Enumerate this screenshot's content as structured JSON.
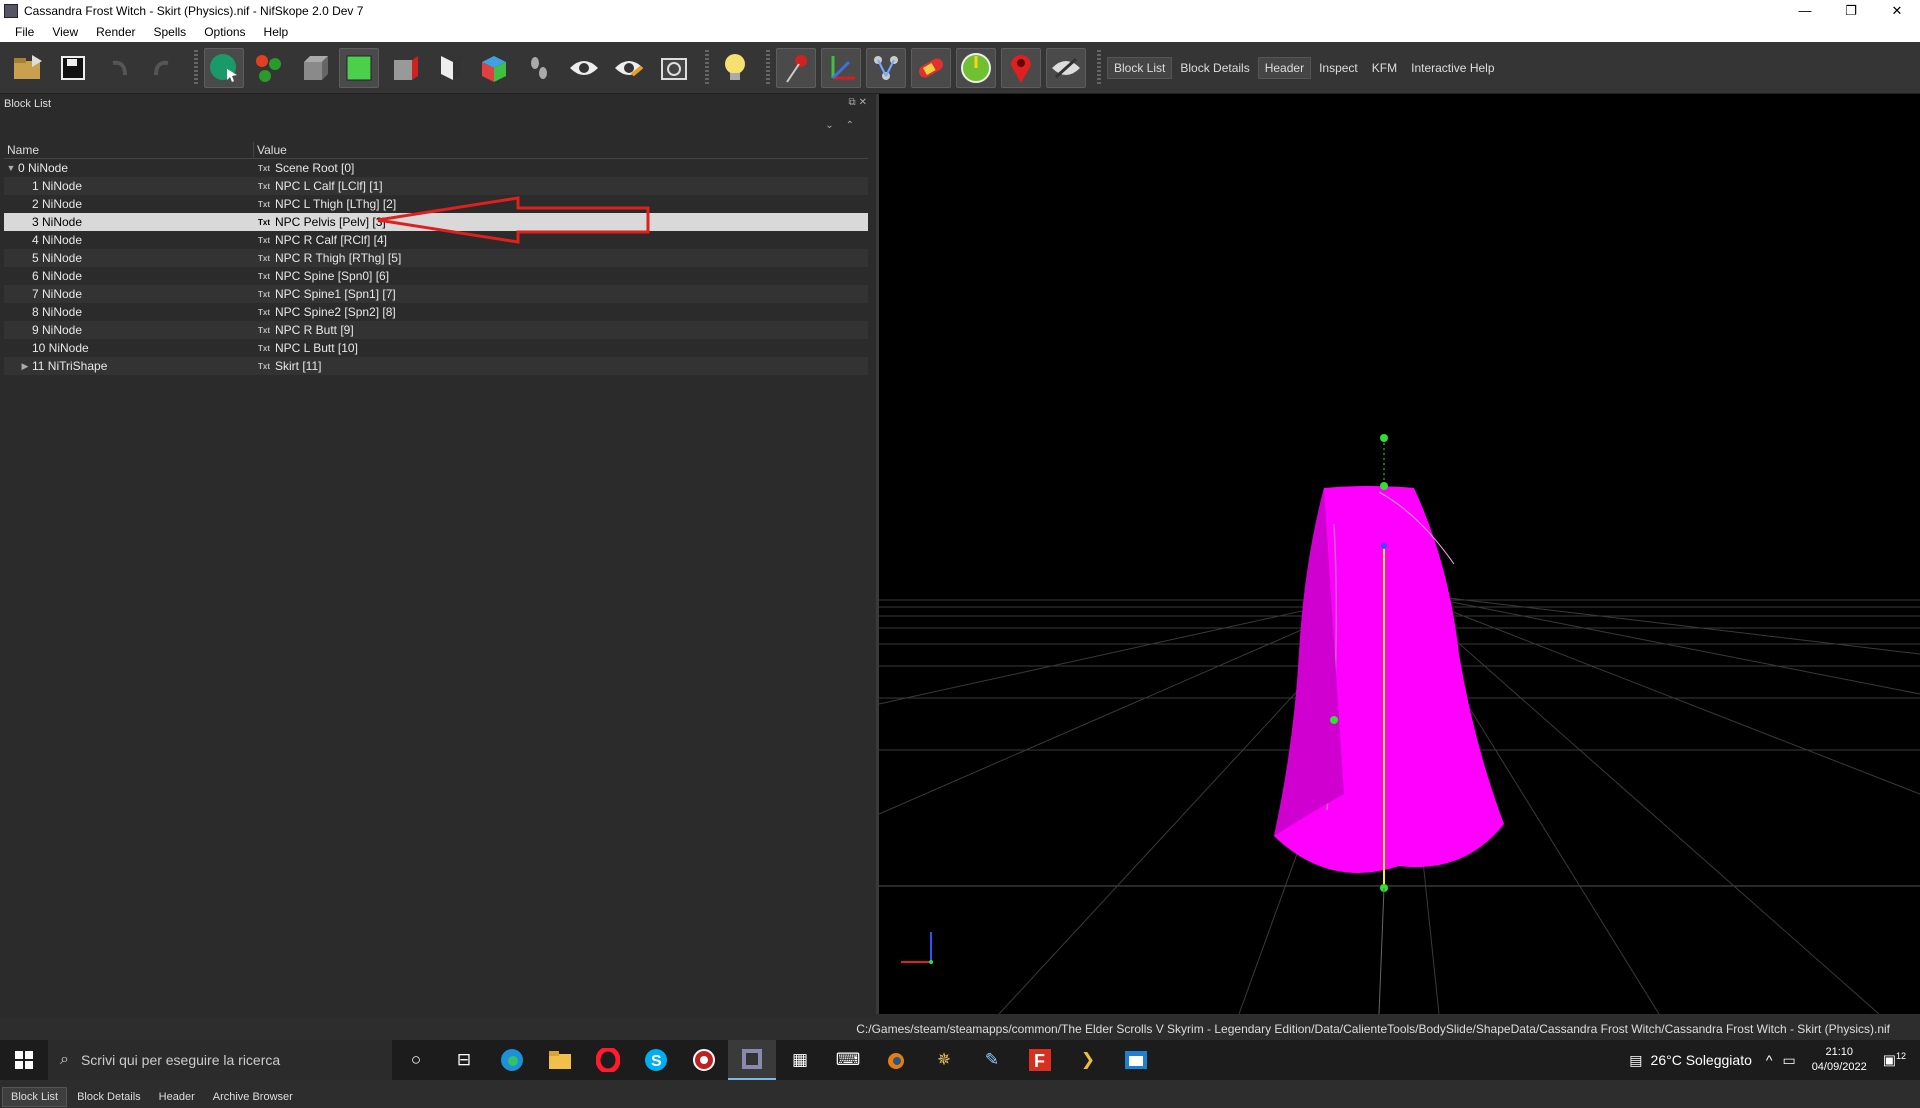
{
  "window": {
    "title": "Cassandra Frost Witch - Skirt (Physics).nif - NifSkope 2.0 Dev 7",
    "controls": [
      "—",
      "❐",
      "✕"
    ]
  },
  "menu": [
    "File",
    "View",
    "Render",
    "Spells",
    "Options",
    "Help"
  ],
  "toolbar": {
    "text_buttons": [
      {
        "label": "Block List",
        "active": true
      },
      {
        "label": "Block Details",
        "active": false
      },
      {
        "label": "Header",
        "active": true
      },
      {
        "label": "Inspect",
        "active": false
      },
      {
        "label": "KFM",
        "active": false
      },
      {
        "label": "Interactive Help",
        "active": false
      }
    ]
  },
  "block_list": {
    "title": "Block List",
    "columns": {
      "name": "Name",
      "value": "Value"
    },
    "rows": [
      {
        "name": "0 NiNode",
        "value": "Scene Root [0]",
        "indent": 0,
        "expander": "▼"
      },
      {
        "name": "1 NiNode",
        "value": "NPC L Calf [LClf] [1]",
        "indent": 1,
        "expander": ""
      },
      {
        "name": "2 NiNode",
        "value": "NPC L Thigh [LThg] [2]",
        "indent": 1,
        "expander": ""
      },
      {
        "name": "3 NiNode",
        "value": "NPC Pelvis [Pelv] [3]",
        "indent": 1,
        "expander": "",
        "selected": true
      },
      {
        "name": "4 NiNode",
        "value": "NPC R Calf [RClf] [4]",
        "indent": 1,
        "expander": ""
      },
      {
        "name": "5 NiNode",
        "value": "NPC R Thigh [RThg] [5]",
        "indent": 1,
        "expander": ""
      },
      {
        "name": "6 NiNode",
        "value": "NPC Spine [Spn0] [6]",
        "indent": 1,
        "expander": ""
      },
      {
        "name": "7 NiNode",
        "value": "NPC Spine1 [Spn1] [7]",
        "indent": 1,
        "expander": ""
      },
      {
        "name": "8 NiNode",
        "value": "NPC Spine2 [Spn2] [8]",
        "indent": 1,
        "expander": ""
      },
      {
        "name": "9 NiNode",
        "value": "NPC R Butt [9]",
        "indent": 1,
        "expander": ""
      },
      {
        "name": "10 NiNode",
        "value": "NPC L Butt [10]",
        "indent": 1,
        "expander": ""
      },
      {
        "name": "11 NiTriShape",
        "value": "Skirt [11]",
        "indent": 1,
        "expander": "▶"
      }
    ],
    "txt_icon": "Txt"
  },
  "bottom_tabs": [
    {
      "label": "Block List",
      "active": true
    },
    {
      "label": "Block Details",
      "active": false
    },
    {
      "label": "Header",
      "active": false
    },
    {
      "label": "Archive Browser",
      "active": false
    }
  ],
  "status_path": "C:/Games/steam/steamapps/common/The Elder Scrolls V Skyrim - Legendary Edition/Data/CalienteTools/BodySlide/ShapeData/Cassandra Frost Witch/Cassandra Frost Witch - Skirt (Physics).nif",
  "taskbar": {
    "search_placeholder": "Scrivi qui per eseguire la ricerca",
    "weather": "26°C  Soleggiato",
    "time": "21:10",
    "date": "04/09/2022",
    "notifications": "12"
  },
  "colors": {
    "mesh": "#ff00ff",
    "selected_row": "#d9d9d9",
    "annotation_arrow": "#e0201c"
  }
}
